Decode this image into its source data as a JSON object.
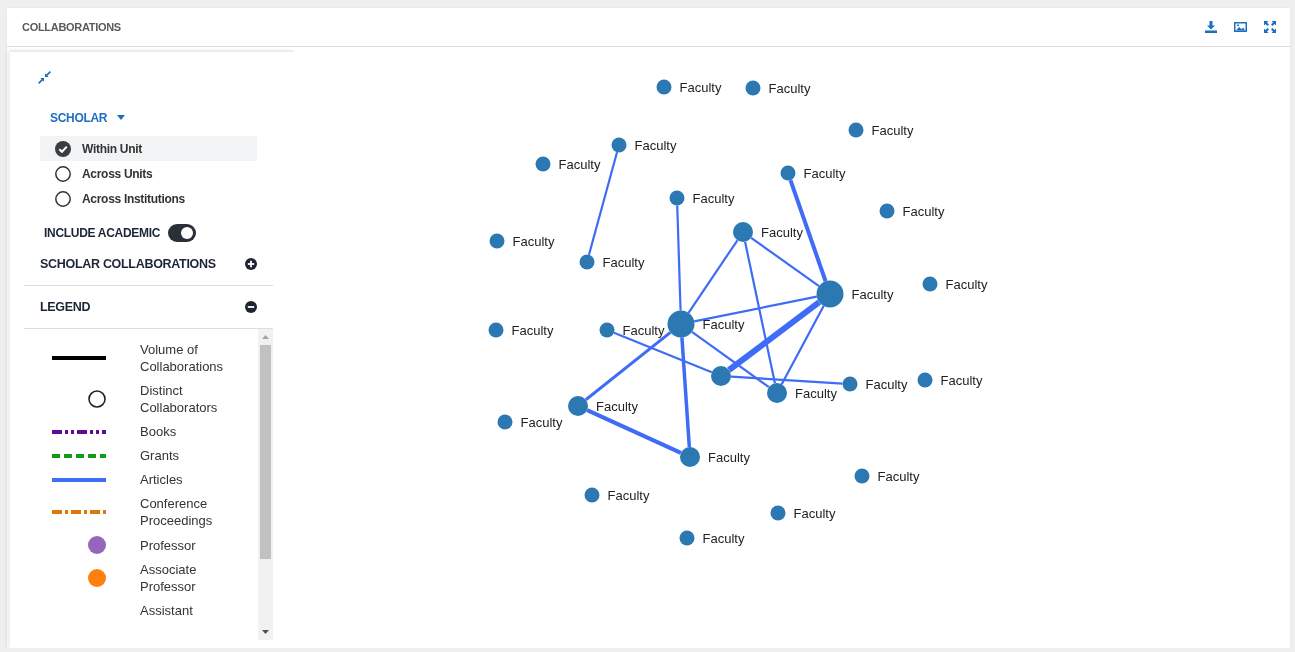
{
  "header": {
    "title": "COLLABORATIONS"
  },
  "panel": {
    "scope": {
      "label": "SCHOLAR",
      "options": [
        {
          "label": "Within Unit",
          "selected": true
        },
        {
          "label": "Across Units",
          "selected": false
        },
        {
          "label": "Across Institutions",
          "selected": false
        }
      ]
    },
    "include_academic": {
      "label": "INCLUDE ACADEMIC",
      "on": true
    },
    "sections": [
      {
        "title": "SCHOLAR COLLABORATIONS",
        "expanded": false
      },
      {
        "title": "LEGEND",
        "expanded": true,
        "items": [
          {
            "label": "Volume of Collaborations",
            "kind": "solid",
            "color": "#000000"
          },
          {
            "label": "Distinct Collaborators",
            "kind": "ring",
            "color": "#222222"
          },
          {
            "label": "Books",
            "kind": "dashdotdot",
            "color": "#5e0b9c"
          },
          {
            "label": "Grants",
            "kind": "dashed",
            "color": "#139a16"
          },
          {
            "label": "Articles",
            "kind": "solid",
            "color": "#3d6ef5"
          },
          {
            "label": "Conference Proceedings",
            "kind": "dashdot",
            "color": "#e0760a"
          },
          {
            "label": "Professor",
            "kind": "dot",
            "color": "#9467bd"
          },
          {
            "label": "Associate Professor",
            "kind": "dot",
            "color": "#ff7f0e"
          },
          {
            "label": "Assistant"
          }
        ]
      }
    ]
  },
  "graph": {
    "nodes": [
      {
        "label": "Faculty",
        "kind": "small"
      },
      {
        "label": "Faculty",
        "kind": "small"
      },
      {
        "label": "Faculty",
        "kind": "small"
      },
      {
        "label": "Faculty",
        "kind": "small"
      },
      {
        "label": "Faculty",
        "kind": "small"
      },
      {
        "label": "Faculty",
        "kind": "small"
      },
      {
        "label": "Faculty",
        "kind": "small"
      },
      {
        "label": "Faculty",
        "kind": "small"
      },
      {
        "label": "Faculty",
        "kind": "medium"
      },
      {
        "label": "Faculty",
        "kind": "small"
      },
      {
        "label": "Faculty",
        "kind": "small"
      },
      {
        "label": "Faculty",
        "kind": "small"
      },
      {
        "label": "Faculty",
        "kind": "large"
      },
      {
        "label": "Faculty",
        "kind": "small"
      },
      {
        "label": "Faculty",
        "kind": "small"
      },
      {
        "label": "Faculty",
        "kind": "large"
      },
      {
        "kind": "medium"
      },
      {
        "label": "Faculty",
        "kind": "medium"
      },
      {
        "label": "Faculty",
        "kind": "small"
      },
      {
        "label": "Faculty",
        "kind": "small"
      },
      {
        "label": "Faculty",
        "kind": "medium"
      },
      {
        "label": "Faculty",
        "kind": "small"
      },
      {
        "label": "Faculty",
        "kind": "medium"
      },
      {
        "label": "Faculty",
        "kind": "small"
      },
      {
        "label": "Faculty",
        "kind": "small"
      },
      {
        "label": "Faculty",
        "kind": "small"
      },
      {
        "label": "Faculty",
        "kind": "small"
      }
    ]
  }
}
